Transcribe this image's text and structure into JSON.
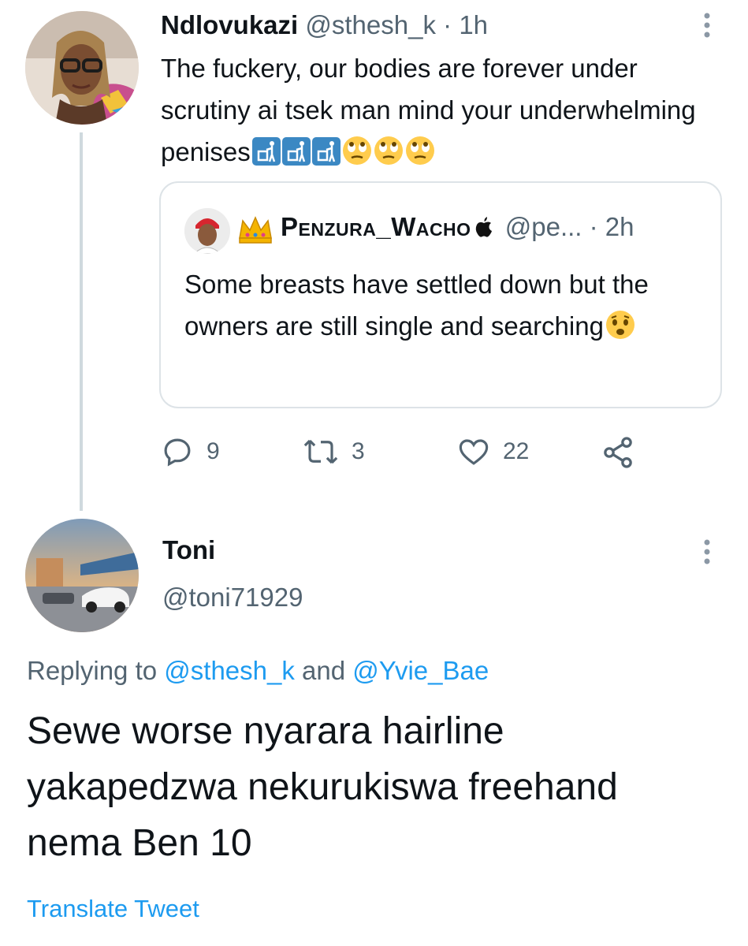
{
  "tweet1": {
    "display_name": "Ndlovukazi",
    "handle": "@sthesh_k",
    "separator": "·",
    "time": "1h",
    "text": "The fuckery, our bodies are forever under scrutiny ai tsek man mind your underwhelming penises",
    "emojis": [
      "litter-bin-icon",
      "litter-bin-icon",
      "litter-bin-icon",
      "eye-roll-icon",
      "eye-roll-icon",
      "eye-roll-icon"
    ],
    "quoted": {
      "display_name": "Penzura_Wacho",
      "handle": "@pe...",
      "separator": "·",
      "time": "2h",
      "text": "Some breasts have settled down but the owners are still single and searching",
      "emojis": [
        "worried-face-icon"
      ]
    },
    "actions": {
      "replies": "9",
      "retweets": "3",
      "likes": "22"
    }
  },
  "tweet2": {
    "display_name": "Toni",
    "handle": "@toni71929",
    "replying_prefix": "Replying to",
    "replying_to": [
      "@sthesh_k",
      "@Yvie_Bae"
    ],
    "replying_conj": "and",
    "text": "Sewe worse nyarara hairline yakapedzwa nekurukiswa freehand nema Ben 10",
    "translate_label": "Translate Tweet"
  },
  "colors": {
    "text_primary": "#0f1419",
    "text_secondary": "#536471",
    "link": "#1d9bf0",
    "border": "#dde3e7",
    "thread_line": "#cfd9de"
  }
}
